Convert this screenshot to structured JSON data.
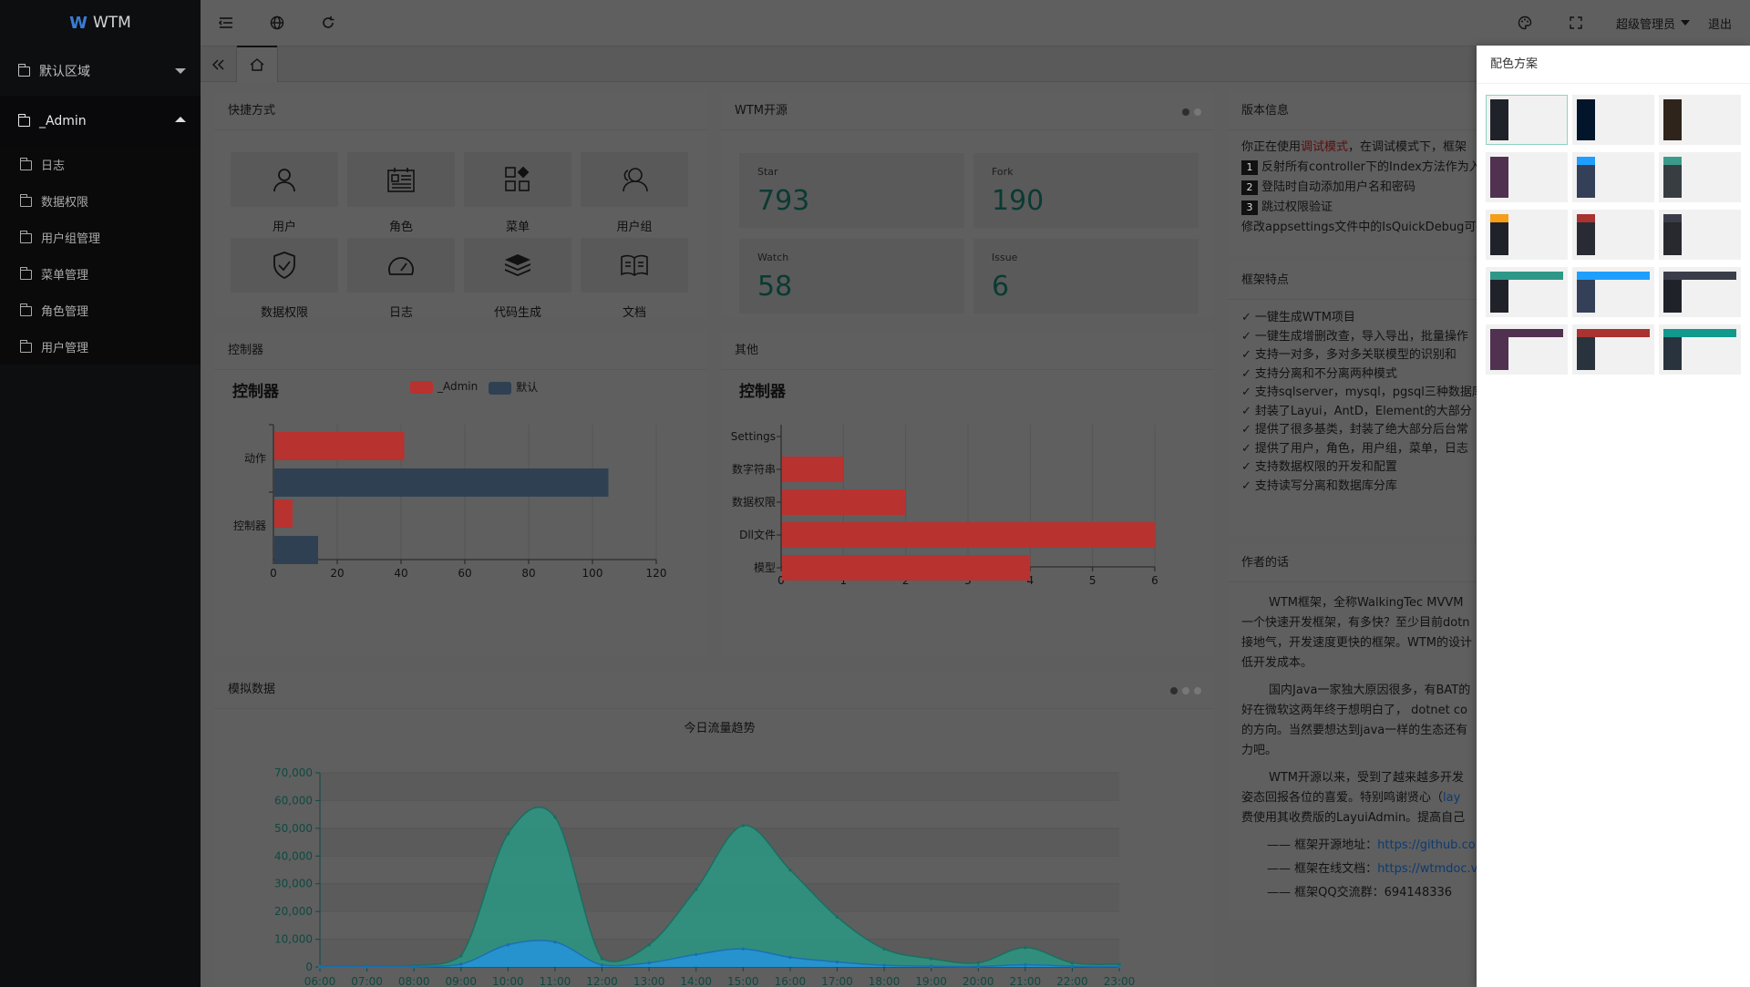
{
  "app": {
    "logo_text": "WTM",
    "logo_mark": "W"
  },
  "sidebar": {
    "groups": [
      {
        "label": "默认区域",
        "open": false
      },
      {
        "label": "_Admin",
        "open": true
      }
    ],
    "items": [
      {
        "label": "日志"
      },
      {
        "label": "数据权限"
      },
      {
        "label": "用户组管理"
      },
      {
        "label": "菜单管理"
      },
      {
        "label": "角色管理"
      },
      {
        "label": "用户管理"
      }
    ]
  },
  "topbar": {
    "user": "超级管理员",
    "logout": "退出"
  },
  "shortcuts": {
    "title": "快捷方式",
    "items": [
      {
        "label": "用户",
        "icon": "user-icon"
      },
      {
        "label": "角色",
        "icon": "role-icon"
      },
      {
        "label": "菜单",
        "icon": "menu-grid-icon"
      },
      {
        "label": "用户组",
        "icon": "users-icon"
      },
      {
        "label": "数据权限",
        "icon": "shield-check-icon"
      },
      {
        "label": "日志",
        "icon": "gauge-icon"
      },
      {
        "label": "代码生成",
        "icon": "layers-icon"
      },
      {
        "label": "文档",
        "icon": "book-icon"
      }
    ]
  },
  "opensource": {
    "title": "WTM开源",
    "stats": [
      {
        "key": "Star",
        "value": "793"
      },
      {
        "key": "Fork",
        "value": "190"
      },
      {
        "key": "Watch",
        "value": "58"
      },
      {
        "key": "Issue",
        "value": "6"
      }
    ]
  },
  "version": {
    "title": "版本信息",
    "line0_pre": "你正在使用",
    "line0_mode": "调试模式",
    "line0_post": "，在调试模式下，框架",
    "items": [
      "反射所有controller下的Index方法作为入",
      "登陆时自动添加用户名和密码",
      "跳过权限验证"
    ],
    "nums": [
      "1",
      "2",
      "3"
    ],
    "footer": "修改appsettings文件中的IsQuickDebug可以"
  },
  "features": {
    "title": "框架特点",
    "items": [
      "一键生成WTM项目",
      "一键生成增删改查，导入导出，批量操作",
      "支持一对多，多对多关联模型的识别和",
      "支持分离和不分离两种模式",
      "支持sqlserver，mysql，pgsql三种数据库",
      "封装了Layui，AntD，Element的大部分",
      "提供了很多基类，封装了绝大部分后台常",
      "提供了用户，角色，用户组，菜单，日志",
      "支持数据权限的开发和配置",
      "支持读写分离和数据库分库"
    ]
  },
  "author": {
    "title": "作者的话",
    "p1": [
      "WTM框架，全称WalkingTec MVVM",
      "一个快速开发框架，有多快？至少目前dotn",
      "接地气，开发速度更快的框架。WTM的设计",
      "低开发成本。"
    ],
    "p2": [
      "国内Java一家独大原因很多，有BAT的",
      "好在微软这两年终于想明白了， dotnet co",
      "的方向。当然要想达到java一样的生态还有",
      "力吧。"
    ],
    "p3": [
      "WTM开源以来，受到了越来越多开发",
      "姿态回报各位的喜爱。特别鸣谢贤心（lay",
      "费使用其收费版的LayuiAdmin。提高自己"
    ],
    "p3_link": "lay",
    "links": [
      {
        "label": "—— 框架开源地址：",
        "value": "https://github.co"
      },
      {
        "label": "—— 框架在线文档：",
        "value": "https://wtmdoc.v"
      },
      {
        "label": "—— 框架QQ交流群：",
        "value": "694148336"
      }
    ]
  },
  "controller_card": {
    "header": "控制器",
    "chart_title": "控制器",
    "legend": [
      "_Admin",
      "默认"
    ]
  },
  "other_card": {
    "header": "其他",
    "chart_title": "控制器"
  },
  "mock_card": {
    "header": "模拟数据",
    "chart_title": "今日流量趋势"
  },
  "panel": {
    "title": "配色方案"
  },
  "colors": {
    "admin_series": "#b8322f",
    "default_series": "#2f4052",
    "area_main": "#2a9a84",
    "area_small": "#2394e0"
  },
  "schemes": [
    {
      "side": "#20222a",
      "header": ""
    },
    {
      "side": "#03152a",
      "header": ""
    },
    {
      "side": "#2e241b",
      "header": ""
    },
    {
      "side": "#50314f",
      "header": ""
    },
    {
      "side": "#344058",
      "header": "#1e9fff"
    },
    {
      "side": "#373d41",
      "header": "#3b9b8b"
    },
    {
      "side": "#20222a",
      "header": "#f59e17"
    },
    {
      "side": "#282b33",
      "header": "#a83330"
    },
    {
      "side": "#28292f",
      "header": "#3a3d49"
    },
    {
      "side": "#20222a",
      "header": "#2f9787"
    },
    {
      "side": "#344058",
      "header": "#1e9fff"
    },
    {
      "side": "#20222a",
      "header": "#3a3d49"
    },
    {
      "side": "#50314f",
      "header": "#50314f"
    },
    {
      "side": "#28333e",
      "header": "#a83330"
    },
    {
      "side": "#28333e",
      "header": "#11998e"
    }
  ],
  "chart_data": [
    {
      "type": "bar",
      "orientation": "horizontal",
      "title": "控制器",
      "categories": [
        "动作",
        "控制器"
      ],
      "series": [
        {
          "name": "_Admin",
          "values": [
            41,
            6
          ]
        },
        {
          "name": "默认",
          "values": [
            105,
            14
          ]
        }
      ],
      "xlim": [
        0,
        120
      ],
      "xticks": [
        "0",
        "20",
        "40",
        "60",
        "80",
        "100",
        "120"
      ],
      "grid": true,
      "legend": "top"
    },
    {
      "type": "bar",
      "orientation": "horizontal",
      "title": "控制器",
      "categories": [
        "Settings",
        "数字符串",
        "数据权限",
        "Dll文件",
        "模型"
      ],
      "values": [
        0,
        1,
        2,
        6,
        4
      ],
      "xlim": [
        0,
        6
      ],
      "xticks": [
        "0",
        "1",
        "2",
        "3",
        "4",
        "5",
        "6"
      ],
      "grid": true
    },
    {
      "type": "area",
      "title": "今日流量趋势",
      "x": [
        "06:00",
        "07:00",
        "08:00",
        "09:00",
        "10:00",
        "11:00",
        "12:00",
        "13:00",
        "14:00",
        "15:00",
        "16:00",
        "17:00",
        "18:00",
        "19:00",
        "20:00",
        "21:00",
        "22:00",
        "23:00"
      ],
      "series": [
        {
          "values": [
            200,
            300,
            500,
            4000,
            48000,
            54000,
            3000,
            8000,
            28000,
            51000,
            35000,
            18000,
            6500,
            3000,
            1500,
            7000,
            1500,
            1000
          ]
        },
        {
          "values": [
            50,
            80,
            120,
            1000,
            8000,
            9000,
            700,
            1500,
            4500,
            6500,
            3500,
            1800,
            600,
            300,
            200,
            800,
            300,
            200
          ]
        }
      ],
      "ylim": [
        0,
        70000
      ],
      "yticks": [
        "0",
        "10,000",
        "20,000",
        "30,000",
        "40,000",
        "50,000",
        "60,000",
        "70,000"
      ],
      "grid": true
    }
  ]
}
